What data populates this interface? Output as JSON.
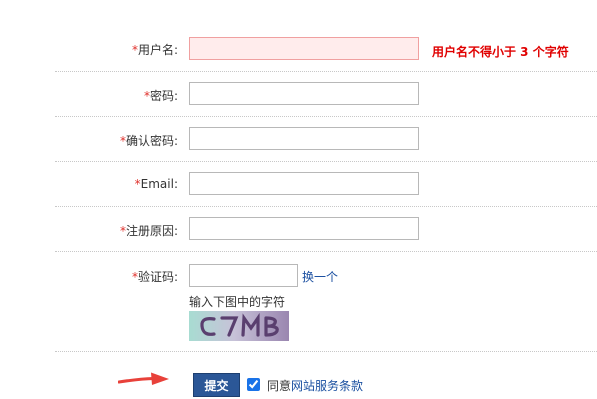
{
  "fields": {
    "username": {
      "required_mark": "*",
      "label": "用户名:",
      "value": "",
      "error": "用户名不得小于 3 个字符"
    },
    "password": {
      "required_mark": "*",
      "label": "密码:",
      "value": ""
    },
    "confirm_password": {
      "required_mark": "*",
      "label": "确认密码:",
      "value": ""
    },
    "email": {
      "required_mark": "*",
      "label": "Email:",
      "value": ""
    },
    "reason": {
      "required_mark": "*",
      "label": "注册原因:",
      "value": ""
    },
    "captcha": {
      "required_mark": "*",
      "label": "验证码:",
      "value": "",
      "refresh_label": "换一个",
      "hint": "输入下图中的字符",
      "image_text": "C7MB"
    }
  },
  "submit": {
    "label": "提交",
    "agree_prefix": "同意",
    "agree_link": "网站服务条款",
    "agree_checked": true
  },
  "colors": {
    "required": "#e0302b",
    "error_text": "#e00000",
    "error_bg": "#ffecec",
    "submit_bg": "#2b5797",
    "link": "#1a4fa0",
    "arrow": "#e8413a"
  },
  "icons": {
    "pointer": "red-arrow-icon"
  }
}
